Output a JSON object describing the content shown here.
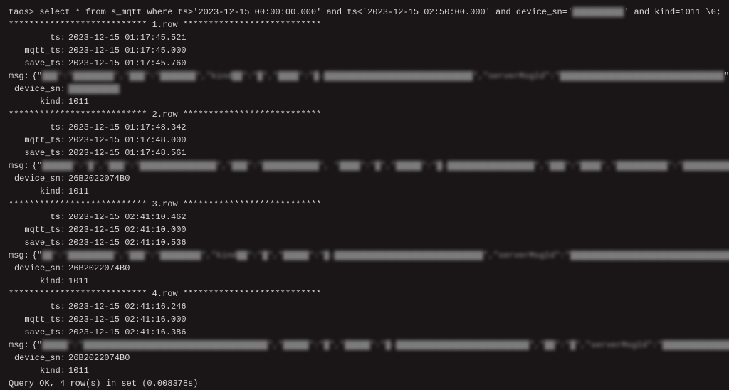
{
  "prompt": "taos>",
  "query": "select * from s_mqtt where ts>'2023-12-15 00:00:00.000' and ts<'2023-12-15 02:50:00.000'  and device_sn='",
  "query_blur": "▓▓▓▓▓▓▓▓▓▓",
  "query_after": "' and kind=1011 \\G;",
  "sep_prefix": "*************************** ",
  "sep_suffix": " ***************************",
  "rows": [
    {
      "label": "1.row",
      "ts": "2023-12-15 01:17:45.521",
      "mqtt_ts": "2023-12-15 01:17:45.000",
      "save_ts": "2023-12-15 01:17:45.760",
      "msg_pre": "{\"",
      "msg_blur": "▓▓▓\":\"▓▓▓▓▓▓▓▓\",\"▓▓▓\":\"▓▓▓▓▓▓▓\",\"kind▓▓\":\"▓\",\"▓▓▓▓\":\"▓-▓▓▓▓▓▓▓▓▓▓▓▓▓▓▓▓▓▓▓▓▓▓▓▓▓▓▓▓▓\",\"serverMsgId\":\"▓▓▓▓▓▓▓▓▓▓▓▓▓▓▓▓▓▓▓▓▓▓▓▓▓▓▓▓▓▓▓▓",
      "msg_post": "\"}",
      "device_sn_blur": "▓▓▓▓▓▓▓▓▓▓",
      "device_sn": "",
      "kind": "1011"
    },
    {
      "label": "2.row",
      "ts": "2023-12-15 01:17:48.342",
      "mqtt_ts": "2023-12-15 01:17:48.000",
      "save_ts": "2023-12-15 01:17:48.561",
      "msg_pre": "{\"",
      "msg_blur": "▓▓▓▓▓▓\":\"▓\",\"▓▓▓\":\"▓▓▓▓▓▓▓▓▓▓▓▓▓▓▓\",\"▓▓▓\":\"▓▓▓▓▓▓▓▓▓▓▓\",      \"▓▓▓▓\":\"▓\",\"▓▓▓▓▓\":\"▓-▓▓▓▓▓▓▓▓▓▓▓▓▓▓▓▓▓\",\"▓▓▓\":\"▓▓▓▓\",\"▓▓▓▓▓▓▓▓▓▓\":\"▓▓▓▓▓▓▓▓▓▓▓▓▓▓▓▓▓▓▓▓▓▓▓▓▓▓▓▓▓▓▓▓▓▓▓▓▓▓▓▓▓▓▓▓▓▓▓▓▓▓▓▓▓▓▓▓▓▓",
      "msg_post": "\"}",
      "device_sn_blur": "",
      "device_sn": "26B2022074B0",
      "kind": "1011"
    },
    {
      "label": "3.row",
      "ts": "2023-12-15 02:41:10.462",
      "mqtt_ts": "2023-12-15 02:41:10.000",
      "save_ts": "2023-12-15 02:41:10.536",
      "msg_pre": "{\"",
      "msg_blur": "▓▓\":\"▓▓▓▓▓▓▓▓▓\",\"▓▓▓\":\"▓▓▓▓▓▓▓▓\",\"kind▓▓\":\"▓\",\"▓▓▓▓▓\":\"▓-▓▓▓▓▓▓▓▓▓▓▓▓▓▓▓▓▓▓▓▓▓▓▓▓▓▓▓▓▓\",\"serverMsgId\":\"▓▓▓▓▓▓▓▓▓▓▓▓▓▓▓▓▓▓▓▓▓▓▓▓▓▓▓▓▓▓▓▓▓▓",
      "msg_post": "\"}",
      "device_sn_blur": "",
      "device_sn": "26B2022074B0",
      "kind": "1011"
    },
    {
      "label": "4.row",
      "ts": "2023-12-15 02:41:16.246",
      "mqtt_ts": "2023-12-15 02:41:16.000",
      "save_ts": "2023-12-15 02:41:16.386",
      "msg_pre": "{\"",
      "msg_blur": "▓▓▓▓▓\":\"▓▓▓▓▓▓▓▓▓▓▓▓▓▓▓▓▓▓▓▓▓▓▓▓▓▓▓▓▓▓▓▓▓▓▓▓\",\"▓▓▓▓▓\":\"▓\",\"▓▓▓▓▓\":\"▓-▓▓▓▓▓▓▓▓▓▓▓▓▓▓▓▓▓▓▓▓▓▓▓▓▓▓\",\"▓▓\":\"▓\",\"serverMsgId\":\"▓▓▓▓▓▓▓▓▓▓▓▓▓▓▓▓▓▓▓▓▓▓▓▓▓▓▓\",       \"▓▓▓▓▓▓▓▓▓▓▓\":\"▓▓▓",
      "msg_post": "\"}",
      "device_sn_blur": "",
      "device_sn": "26B2022074B0",
      "kind": "1011"
    }
  ],
  "labels": {
    "ts": "ts:",
    "mqtt_ts": "mqtt_ts:",
    "save_ts": "save_ts:",
    "msg": "msg:",
    "device_sn": "device_sn:",
    "kind": "kind:"
  },
  "footer": "Query OK, 4 row(s) in set (0.008378s)"
}
